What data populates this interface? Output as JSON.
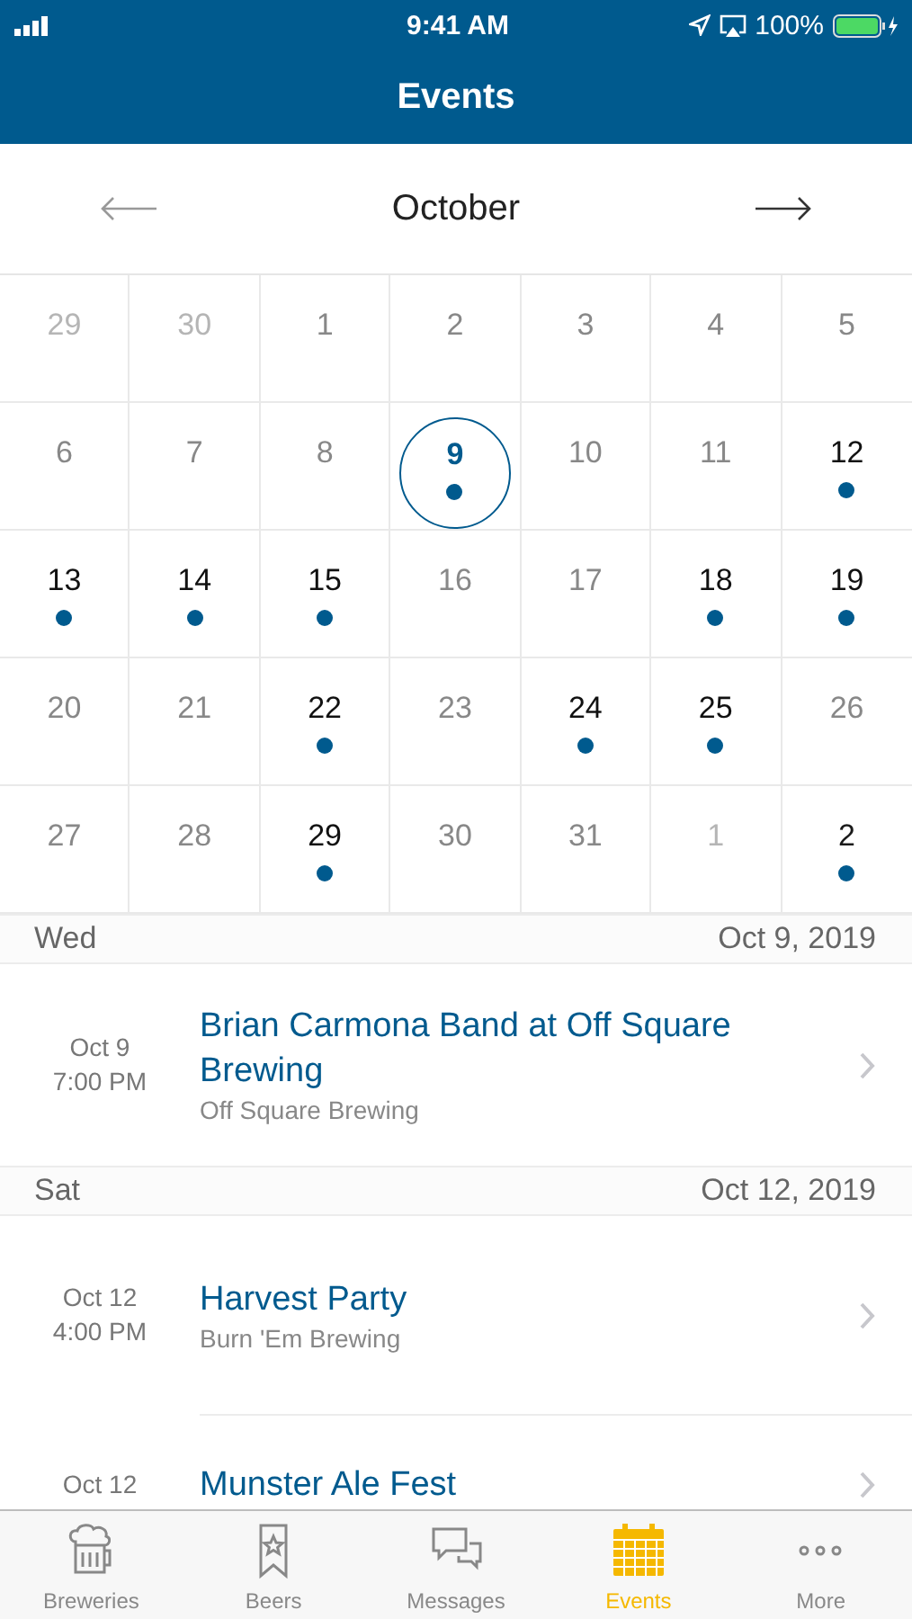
{
  "status_bar": {
    "time": "9:41 AM",
    "battery": "100%"
  },
  "header": {
    "title": "Events"
  },
  "calendar": {
    "month": "October",
    "weeks": [
      [
        {
          "label": "29",
          "outside": true,
          "event": false,
          "selected": false
        },
        {
          "label": "30",
          "outside": true,
          "event": false,
          "selected": false
        },
        {
          "label": "1",
          "outside": false,
          "event": false,
          "selected": false
        },
        {
          "label": "2",
          "outside": false,
          "event": false,
          "selected": false
        },
        {
          "label": "3",
          "outside": false,
          "event": false,
          "selected": false
        },
        {
          "label": "4",
          "outside": false,
          "event": false,
          "selected": false
        },
        {
          "label": "5",
          "outside": false,
          "event": false,
          "selected": false
        }
      ],
      [
        {
          "label": "6",
          "outside": false,
          "event": false,
          "selected": false
        },
        {
          "label": "7",
          "outside": false,
          "event": false,
          "selected": false
        },
        {
          "label": "8",
          "outside": false,
          "event": false,
          "selected": false
        },
        {
          "label": "9",
          "outside": false,
          "event": true,
          "selected": true
        },
        {
          "label": "10",
          "outside": false,
          "event": false,
          "selected": false
        },
        {
          "label": "11",
          "outside": false,
          "event": false,
          "selected": false
        },
        {
          "label": "12",
          "outside": false,
          "event": true,
          "selected": false
        }
      ],
      [
        {
          "label": "13",
          "outside": false,
          "event": true,
          "selected": false
        },
        {
          "label": "14",
          "outside": false,
          "event": true,
          "selected": false
        },
        {
          "label": "15",
          "outside": false,
          "event": true,
          "selected": false
        },
        {
          "label": "16",
          "outside": false,
          "event": false,
          "selected": false
        },
        {
          "label": "17",
          "outside": false,
          "event": false,
          "selected": false
        },
        {
          "label": "18",
          "outside": false,
          "event": true,
          "selected": false
        },
        {
          "label": "19",
          "outside": false,
          "event": true,
          "selected": false
        }
      ],
      [
        {
          "label": "20",
          "outside": false,
          "event": false,
          "selected": false
        },
        {
          "label": "21",
          "outside": false,
          "event": false,
          "selected": false
        },
        {
          "label": "22",
          "outside": false,
          "event": true,
          "selected": false
        },
        {
          "label": "23",
          "outside": false,
          "event": false,
          "selected": false
        },
        {
          "label": "24",
          "outside": false,
          "event": true,
          "selected": false
        },
        {
          "label": "25",
          "outside": false,
          "event": true,
          "selected": false
        },
        {
          "label": "26",
          "outside": false,
          "event": false,
          "selected": false
        }
      ],
      [
        {
          "label": "27",
          "outside": false,
          "event": false,
          "selected": false
        },
        {
          "label": "28",
          "outside": false,
          "event": false,
          "selected": false
        },
        {
          "label": "29",
          "outside": false,
          "event": true,
          "selected": false
        },
        {
          "label": "30",
          "outside": false,
          "event": false,
          "selected": false
        },
        {
          "label": "31",
          "outside": false,
          "event": false,
          "selected": false
        },
        {
          "label": "1",
          "outside": true,
          "event": false,
          "selected": false
        },
        {
          "label": "2",
          "outside": true,
          "event": true,
          "selected": false
        }
      ]
    ]
  },
  "sections": [
    {
      "weekday": "Wed",
      "date": "Oct 9, 2019",
      "events": [
        {
          "date": "Oct 9",
          "time": "7:00 PM",
          "title": "Brian Carmona Band at Off Square Brewing",
          "venue": "Off Square Brewing"
        }
      ]
    },
    {
      "weekday": "Sat",
      "date": "Oct 12, 2019",
      "events": [
        {
          "date": "Oct 12",
          "time": "4:00 PM",
          "title": "Harvest Party",
          "venue": "Burn 'Em Brewing"
        },
        {
          "date": "Oct 12",
          "title": "Munster Ale Fest"
        }
      ]
    }
  ],
  "tab_bar": [
    {
      "label": "Breweries",
      "selected": false
    },
    {
      "label": "Beers",
      "selected": false
    },
    {
      "label": "Messages",
      "selected": false
    },
    {
      "label": "Events",
      "selected": true
    },
    {
      "label": "More",
      "selected": false
    }
  ]
}
